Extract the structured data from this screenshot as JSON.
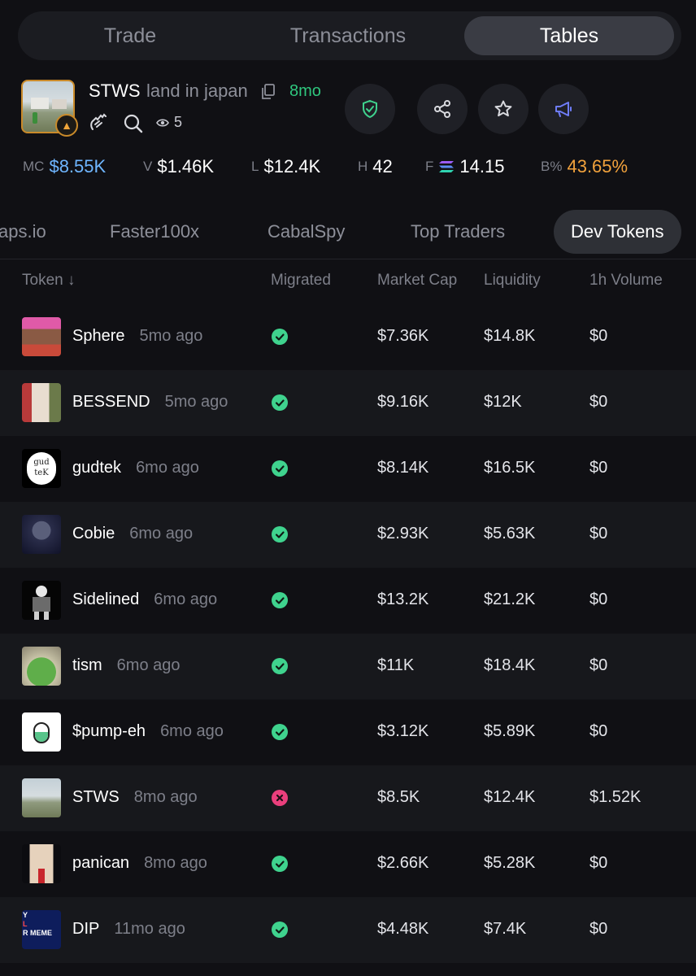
{
  "top_tabs": [
    "Trade",
    "Transactions",
    "Tables"
  ],
  "token": {
    "ticker": "STWS",
    "name": "land in japan",
    "age": "8mo",
    "viewers": "5"
  },
  "stats": [
    {
      "label": "MC",
      "value": "$8.55K",
      "color": "#6fb6ff"
    },
    {
      "label": "V",
      "value": "$1.46K",
      "color": "#ffffff"
    },
    {
      "label": "L",
      "value": "$12.4K",
      "color": "#ffffff"
    },
    {
      "label": "H",
      "value": "42",
      "color": "#ffffff"
    },
    {
      "label": "F",
      "value": "14.15",
      "color": "#ffffff"
    },
    {
      "label": "B%",
      "value": "43.65%",
      "color": "#f2a23c"
    }
  ],
  "sub_tabs": [
    "aps.io",
    "Faster100x",
    "CabalSpy",
    "Top Traders",
    "Dev Tokens"
  ],
  "table": {
    "headers": [
      "Token ↓",
      "Migrated",
      "Market Cap",
      "Liquidity",
      "1h Volume"
    ],
    "rows": [
      {
        "name": "Sphere",
        "age": "5mo ago",
        "migrated": true,
        "mc": "$7.36K",
        "liq": "$14.8K",
        "vol": "$0"
      },
      {
        "name": "BESSEND",
        "age": "5mo ago",
        "migrated": true,
        "mc": "$9.16K",
        "liq": "$12K",
        "vol": "$0"
      },
      {
        "name": "gudtek",
        "age": "6mo ago",
        "migrated": true,
        "mc": "$8.14K",
        "liq": "$16.5K",
        "vol": "$0"
      },
      {
        "name": "Cobie",
        "age": "6mo ago",
        "migrated": true,
        "mc": "$2.93K",
        "liq": "$5.63K",
        "vol": "$0"
      },
      {
        "name": "Sidelined",
        "age": "6mo ago",
        "migrated": true,
        "mc": "$13.2K",
        "liq": "$21.2K",
        "vol": "$0"
      },
      {
        "name": "tism",
        "age": "6mo ago",
        "migrated": true,
        "mc": "$11K",
        "liq": "$18.4K",
        "vol": "$0"
      },
      {
        "name": "$pump-eh",
        "age": "6mo ago",
        "migrated": true,
        "mc": "$3.12K",
        "liq": "$5.89K",
        "vol": "$0"
      },
      {
        "name": "STWS",
        "age": "8mo ago",
        "migrated": false,
        "mc": "$8.5K",
        "liq": "$12.4K",
        "vol": "$1.52K"
      },
      {
        "name": "panican",
        "age": "8mo ago",
        "migrated": true,
        "mc": "$2.66K",
        "liq": "$5.28K",
        "vol": "$0"
      },
      {
        "name": "DIP",
        "age": "11mo ago",
        "migrated": true,
        "mc": "$4.48K",
        "liq": "$7.4K",
        "vol": "$0"
      }
    ]
  },
  "avatar_art": {
    "gudtek": [
      "gud",
      "teK"
    ],
    "DIP": [
      "Y",
      "L",
      "R MEME"
    ]
  }
}
